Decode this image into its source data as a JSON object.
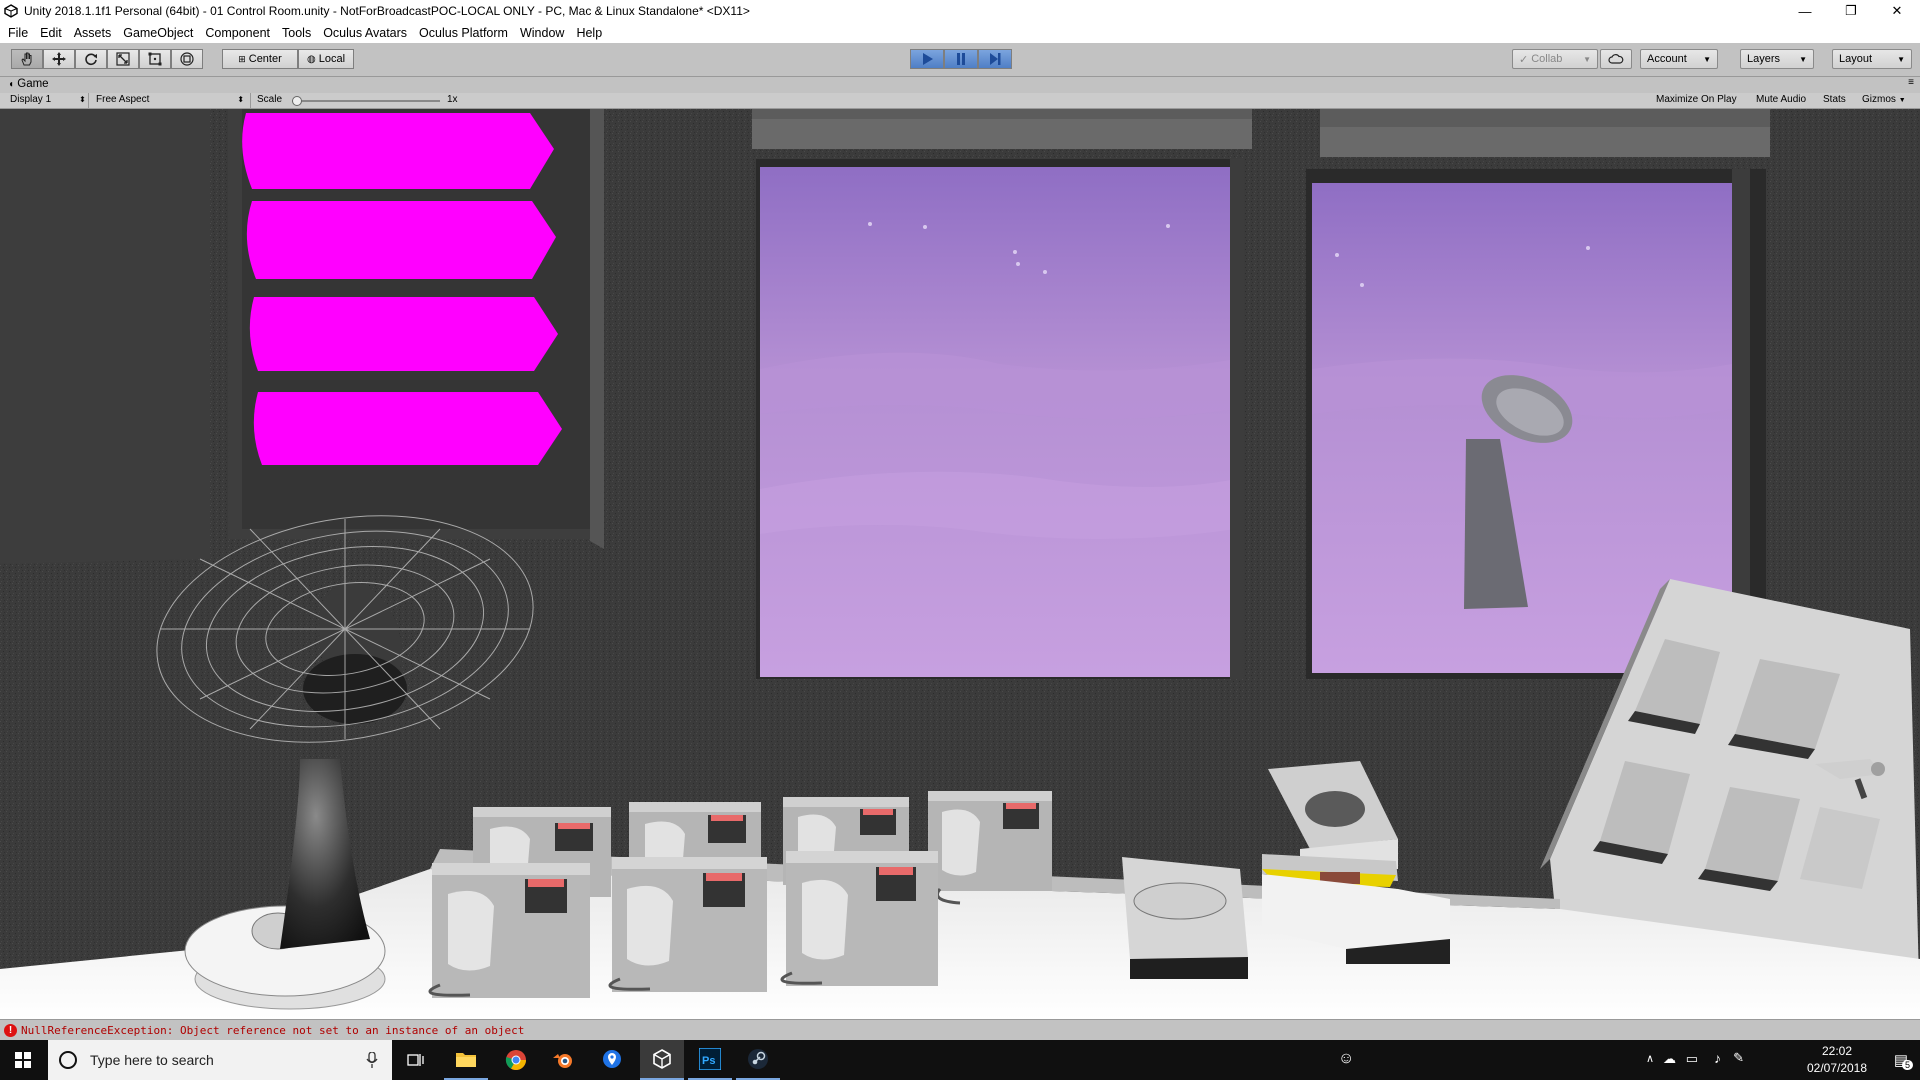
{
  "window": {
    "title": "Unity 2018.1.1f1 Personal (64bit) - 01 Control Room.unity - NotForBroadcastPOC-LOCAL ONLY - PC, Mac & Linux Standalone* <DX11>",
    "minimize": "—",
    "maximize": "❐",
    "close": "✕"
  },
  "menu": [
    "File",
    "Edit",
    "Assets",
    "GameObject",
    "Component",
    "Tools",
    "Oculus Avatars",
    "Oculus Platform",
    "Window",
    "Help"
  ],
  "toolbar": {
    "pivot_label": "Center",
    "space_label": "Local",
    "collab_label": "Collab",
    "account_label": "Account",
    "layers_label": "Layers",
    "layout_label": "Layout"
  },
  "game_tab": {
    "label": "Game",
    "display": "Display 1",
    "aspect": "Free Aspect",
    "scale_label": "Scale",
    "scale_value": "1x",
    "scale_level": 0.0,
    "maximize_on_play": "Maximize On Play",
    "mute_audio": "Mute Audio",
    "stats": "Stats",
    "gizmos": "Gizmos"
  },
  "status": {
    "message": "NullReferenceException: Object reference not set to an instance of an object"
  },
  "taskbar": {
    "search_placeholder": "Type here to search",
    "time": "22:02",
    "date": "02/07/2018",
    "notifications": "5"
  },
  "colors": {
    "accent_play": "#4f7fc6",
    "magenta_panel": "#ff00ff",
    "sky": "#b38ad1",
    "error": "#b00000"
  }
}
